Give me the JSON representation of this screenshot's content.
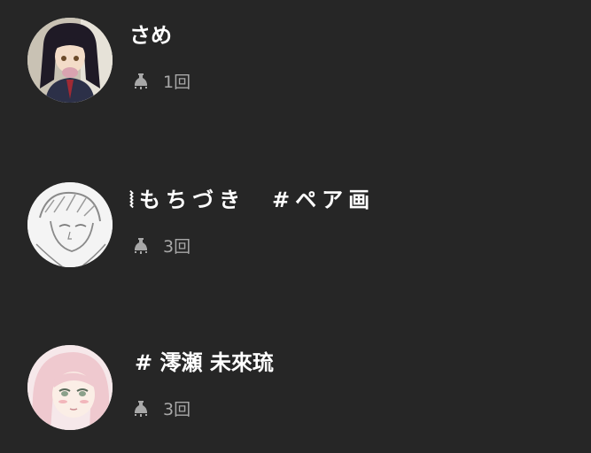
{
  "users": [
    {
      "name": "さめ",
      "count": "1回",
      "icon": "bell-icon",
      "avatar": "anime-girl-dark-hair-avatar"
    },
    {
      "name": "⦚もちづき　#ペア画",
      "count": "3回",
      "icon": "bell-icon",
      "avatar": "sketch-boy-avatar"
    },
    {
      "name": "# 澪瀬 未來琉",
      "count": "3回",
      "icon": "bell-icon",
      "avatar": "pink-hair-girl-avatar"
    }
  ],
  "colors": {
    "background": "#262626",
    "name_text": "#ffffff",
    "meta_text": "#a8a8a8"
  }
}
